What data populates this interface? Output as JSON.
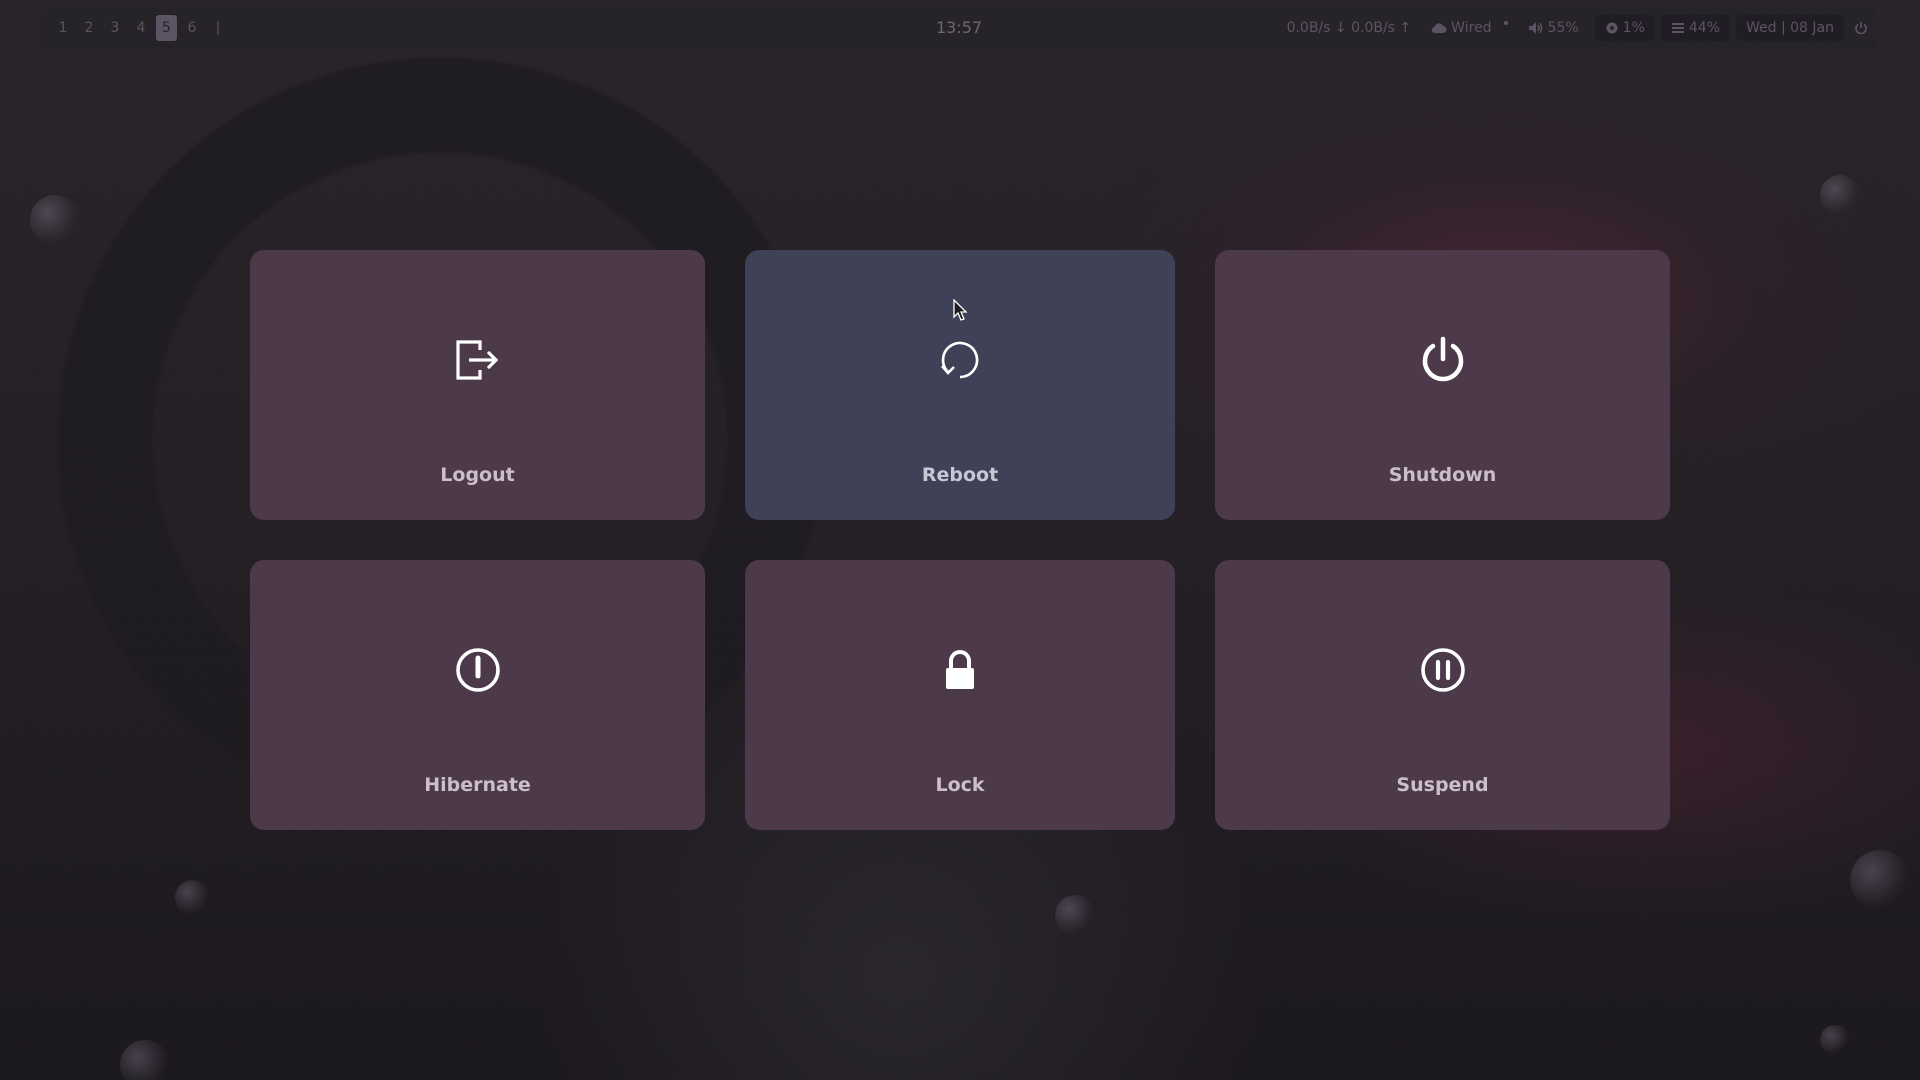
{
  "topbar": {
    "workspaces": [
      "1",
      "2",
      "3",
      "4",
      "5",
      "6",
      "|"
    ],
    "active_workspace": "5",
    "clock": "13:57",
    "network_speed": "0.0B/s ↓ 0.0B/s ↑",
    "network_icon": "cloud-icon",
    "network_label": "Wired",
    "volume_icon": "speaker-icon",
    "volume": "55%",
    "cpu_icon": "cpu-icon",
    "cpu": "1%",
    "memory_icon": "memory-icon",
    "memory": "44%",
    "date": "Wed | 08 Jan",
    "power_icon": "power-icon"
  },
  "menu": {
    "selected": "Reboot",
    "items": [
      {
        "label": "Logout",
        "icon": "logout-icon"
      },
      {
        "label": "Reboot",
        "icon": "reboot-icon"
      },
      {
        "label": "Shutdown",
        "icon": "power-icon"
      },
      {
        "label": "Hibernate",
        "icon": "hibernate-icon"
      },
      {
        "label": "Lock",
        "icon": "lock-icon"
      },
      {
        "label": "Suspend",
        "icon": "pause-icon"
      }
    ]
  },
  "colors": {
    "tile": "#4c3a4a",
    "tile_selected": "#3f4256",
    "label": "#cdbfca",
    "icon": "#ffffff"
  }
}
